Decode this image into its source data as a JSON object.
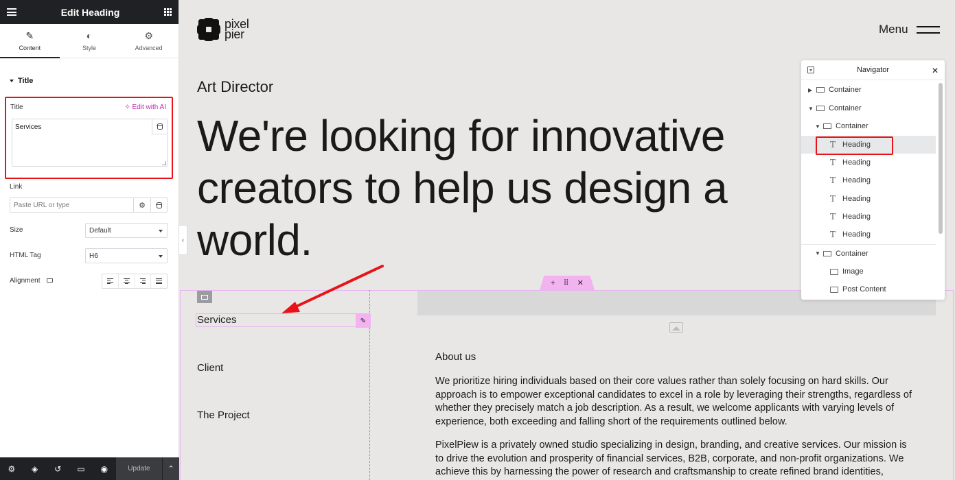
{
  "panel": {
    "title": "Edit Heading",
    "tabs": [
      {
        "label": "Content",
        "icon": "pencil-icon"
      },
      {
        "label": "Style",
        "icon": "half-circle-icon"
      },
      {
        "label": "Advanced",
        "icon": "gear-icon"
      }
    ],
    "section": "Title",
    "title_field": {
      "label": "Title",
      "ai_label": "Edit with AI",
      "value": "Services"
    },
    "link_field": {
      "label": "Link",
      "placeholder": "Paste URL or type"
    },
    "size": {
      "label": "Size",
      "value": "Default"
    },
    "html_tag": {
      "label": "HTML Tag",
      "value": "H6"
    },
    "alignment": {
      "label": "Alignment"
    },
    "footer": {
      "update_label": "Update"
    }
  },
  "page": {
    "logo_line1": "pixel",
    "logo_line2": "pier",
    "menu_label": "Menu",
    "role": "Art Director",
    "hero": "We're looking for innovative creators to help us design a world.",
    "list": [
      "Services",
      "Client",
      "The Project"
    ],
    "about_heading": "About us",
    "paragraphs": [
      "We prioritize hiring individuals based on their core values rather than solely focusing on hard skills. Our approach is to empower exceptional candidates to excel in a role by leveraging their strengths, regardless of whether they precisely match a job description. As a result, we welcome applicants with varying levels of experience, both exceeding and falling short of the requirements outlined below.",
      "PixelPiew is a privately owned studio specializing in design, branding, and creative services. Our mission is to drive the evolution and prosperity of financial services, B2B, corporate, and non-profit organizations. We achieve this by harnessing the power of research and craftsmanship to create refined brand identities,"
    ]
  },
  "navigator": {
    "title": "Navigator",
    "items": [
      "Container",
      "Container",
      "Container",
      "Heading",
      "Heading",
      "Heading",
      "Heading",
      "Heading",
      "Heading",
      "Container",
      "Image",
      "Post Content"
    ]
  },
  "colors": {
    "highlight": "#e81318",
    "ai_accent": "#c722b5",
    "selection": "#f3b3f0",
    "panel_dark": "#1f2124"
  }
}
